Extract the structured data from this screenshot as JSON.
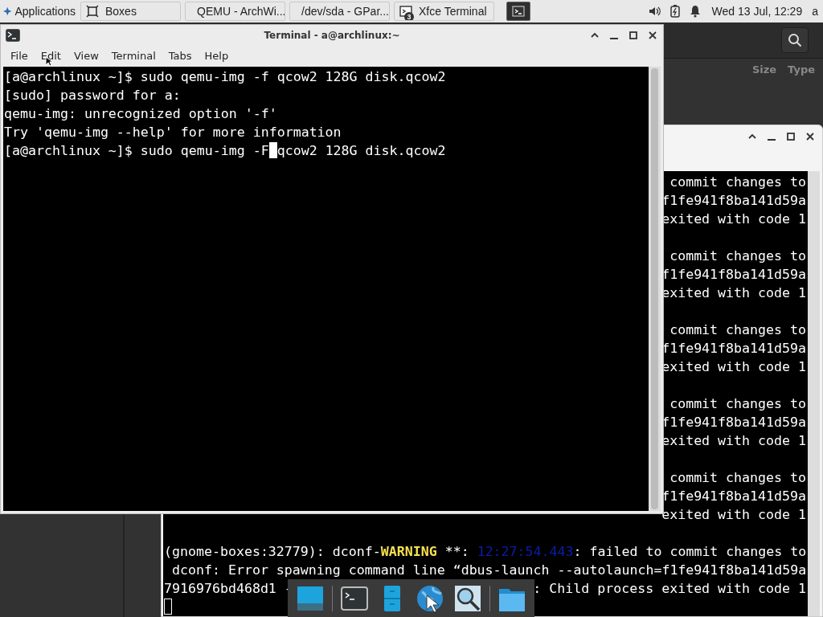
{
  "panel": {
    "applications_label": "Applications",
    "tasks": [
      {
        "kind": "boxes",
        "label": "Boxes",
        "selected": false
      },
      {
        "kind": "browser",
        "label": "QEMU - ArchWi...",
        "selected": false
      },
      {
        "kind": "gparted",
        "label": "/dev/sda - GPar...",
        "selected": false
      },
      {
        "kind": "terminal",
        "label": "Xfce Terminal",
        "badge": "3",
        "selected": false
      },
      {
        "kind": "terminal-small",
        "selected": true
      }
    ],
    "clock": "Wed 13 Jul, 12:29",
    "user": "a"
  },
  "background_app": {
    "column_headers": [
      "Size",
      "Type"
    ]
  },
  "back_terminal": {
    "cursor_focused": false,
    "lines": [
      {
        "kind": "fragment",
        "text": " commit changes to"
      },
      {
        "kind": "fragment",
        "text": "f1fe941f8ba141d59a"
      },
      {
        "kind": "fragment",
        "text": "exited with code 1"
      },
      {
        "kind": "blank"
      },
      {
        "kind": "fragment",
        "text": " commit changes to"
      },
      {
        "kind": "fragment",
        "text": "f1fe941f8ba141d59a"
      },
      {
        "kind": "fragment",
        "text": "exited with code 1"
      },
      {
        "kind": "blank"
      },
      {
        "kind": "fragment",
        "text": " commit changes to"
      },
      {
        "kind": "fragment",
        "text": "f1fe941f8ba141d59a"
      },
      {
        "kind": "fragment",
        "text": "exited with code 1"
      },
      {
        "kind": "blank"
      },
      {
        "kind": "fragment",
        "text": " commit changes to"
      },
      {
        "kind": "fragment",
        "text": "f1fe941f8ba141d59a"
      },
      {
        "kind": "fragment",
        "text": "exited with code 1"
      },
      {
        "kind": "blank"
      },
      {
        "kind": "fragment",
        "text": " commit changes to"
      },
      {
        "kind": "fragment",
        "text": "f1fe941f8ba141d59a"
      },
      {
        "kind": "fragment",
        "text": "exited with code 1"
      },
      {
        "kind": "blank"
      },
      {
        "kind": "segments",
        "segments": [
          {
            "kind": "plain",
            "text": "(gnome-boxes:32779): dconf-"
          },
          {
            "kind": "warning",
            "text": "WARNING"
          },
          {
            "kind": "plain",
            "text": " **: "
          },
          {
            "kind": "timestamp",
            "text": "12:27:54.443"
          },
          {
            "kind": "plain",
            "text": ": failed to commit changes to"
          }
        ]
      },
      {
        "kind": "full",
        "text": " dconf: Error spawning command line “dbus-launch --autolaunch=f1fe941f8ba141d59a"
      },
      {
        "kind": "split",
        "left": "7916976bd468d1 -",
        "right": ": Child process exited with code 1"
      },
      {
        "kind": "cursor"
      }
    ]
  },
  "terminal": {
    "title": "Terminal - a@archlinux:~",
    "menu": [
      "File",
      "Edit",
      "View",
      "Terminal",
      "Tabs",
      "Help"
    ],
    "cursor_focused": true,
    "lines": [
      {
        "text": "[a@archlinux ~]$ sudo qemu-img -f qcow2 128G disk.qcow2"
      },
      {
        "text": "[sudo] password for a:"
      },
      {
        "text": "qemu-img: unrecognized option '-f'"
      },
      {
        "text": "Try 'qemu-img --help' for more information"
      },
      {
        "text": "[a@archlinux ~]$ sudo qemu-img -F",
        "after_cursor": "qcow2 128G disk.qcow2"
      }
    ]
  },
  "dock": {
    "items": [
      {
        "kind": "desktop"
      },
      {
        "kind": "terminal"
      },
      {
        "kind": "cabinet"
      },
      {
        "kind": "browser"
      },
      {
        "kind": "search"
      },
      {
        "kind": "folder"
      }
    ]
  }
}
